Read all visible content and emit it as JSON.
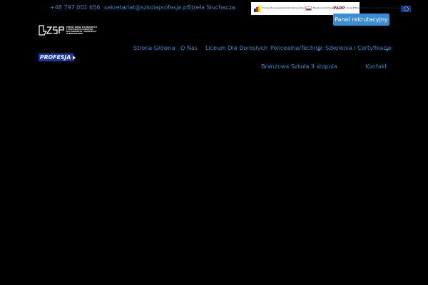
{
  "topbar": {
    "phone": "+48 797 001 656",
    "email": "sekretariat@szkolaprofesja.pl",
    "student_zone": "Strefa Słuchacza"
  },
  "eu_banner": {
    "program_text": "Fundusze Europejskie Wiedza Edukacja Rozwój",
    "country_text": "Rzeczpospolita Polska",
    "agency": "PARP",
    "agency_sub": "Grupa PFR",
    "union_text": "Unia Europejska Europejski Fundusz Społeczny"
  },
  "header": {
    "panel_button": "Panel rekrutacyjny",
    "logo_text_lines": [
      "ZESPÓŁ SZKÓŁ TECHNICZNYCH",
      "I POLICEALNYCH PROFESJA",
      "DLA MŁODZIEŻY I DOROSŁYCH",
      "W BIAŁYMSTOKU"
    ],
    "brand_name": "PROFESJA"
  },
  "nav": {
    "items": [
      "Strona Główna",
      "O Nas",
      "Liceum Dla Dorosłych",
      "Policealna/Technik",
      "Szkolenia i Certyfikacje",
      "Branżowa Szkoła II stopnia",
      "Kontakt"
    ]
  },
  "colors": {
    "background": "#000000",
    "link": "#3d84c6",
    "button": "#3b8cd3",
    "brand_blue": "#1e3a9c"
  }
}
